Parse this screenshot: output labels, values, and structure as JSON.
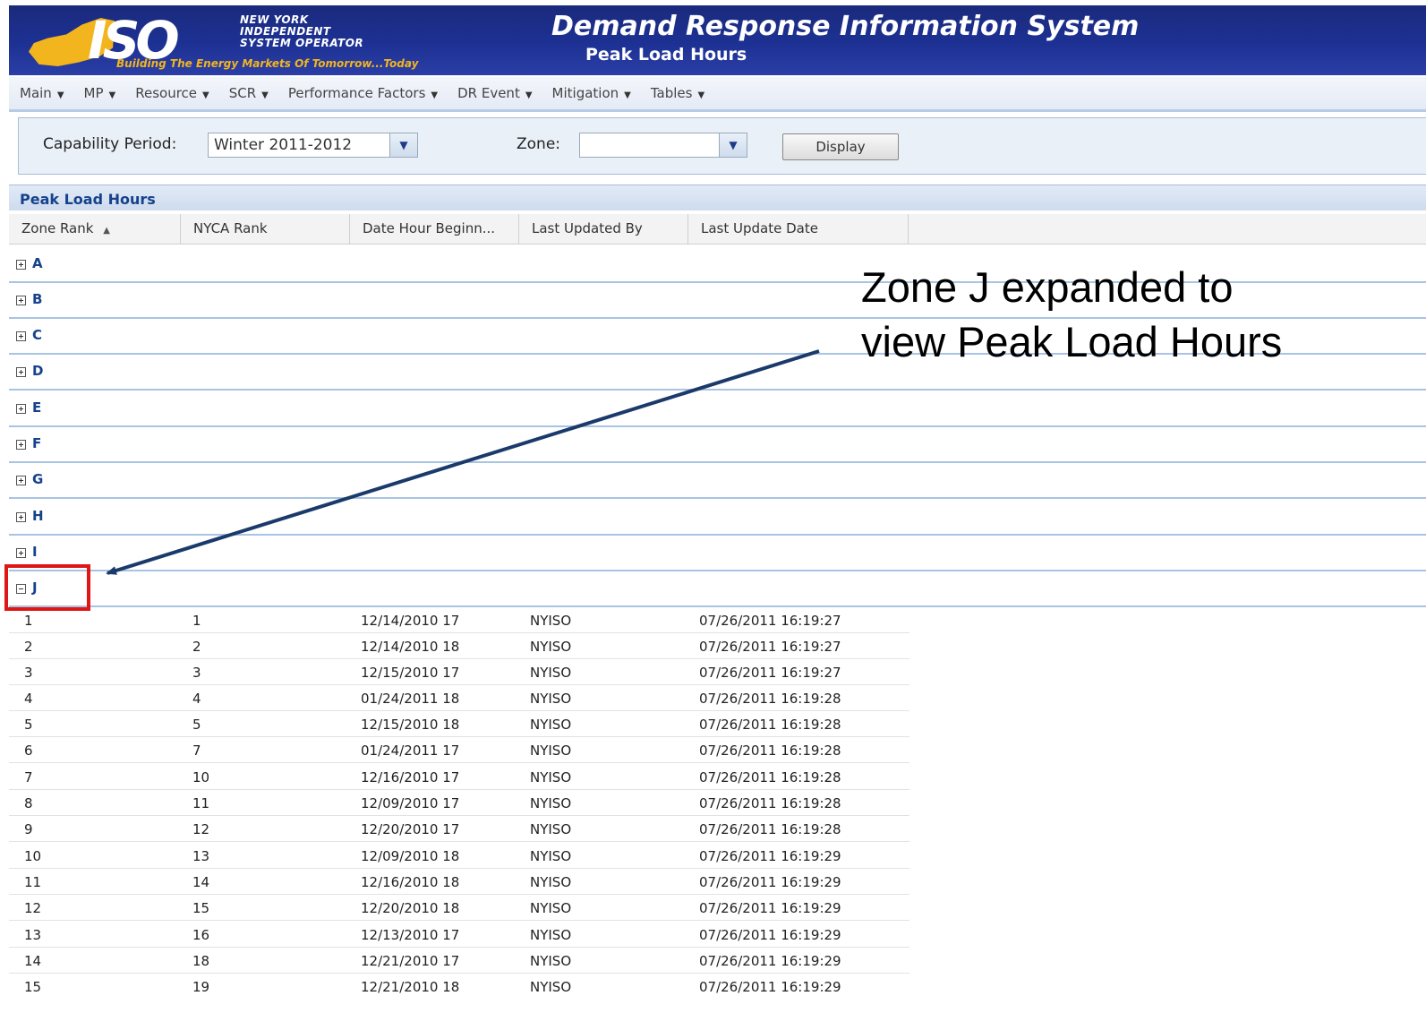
{
  "header": {
    "logo_text": "ISO",
    "logo_lines": [
      "NEW YORK",
      "INDEPENDENT",
      "SYSTEM OPERATOR"
    ],
    "logo_tagline": "Building The Energy Markets Of Tomorrow...Today",
    "app_title": "Demand Response Information System",
    "page_subtitle": "Peak Load Hours"
  },
  "menu": [
    "Main",
    "MP",
    "Resource",
    "SCR",
    "Performance Factors",
    "DR Event",
    "Mitigation",
    "Tables"
  ],
  "filters": {
    "capability_period_label": "Capability Period:",
    "capability_period_value": "Winter 2011-2012",
    "zone_label": "Zone:",
    "zone_value": "",
    "display_button": "Display"
  },
  "grid": {
    "title": "Peak Load Hours",
    "columns": [
      "Zone Rank",
      "NYCA Rank",
      "Date Hour Beginn...",
      "Last Updated By",
      "Last Update Date"
    ],
    "sort_column": "Zone Rank",
    "sort_direction": "ascending",
    "collapsed_groups": [
      "A",
      "B",
      "C",
      "D",
      "E",
      "F",
      "G",
      "H",
      "I"
    ],
    "expanded_group": "J",
    "rows": [
      [
        "1",
        "1",
        "12/14/2010 17",
        "NYISO",
        "07/26/2011 16:19:27"
      ],
      [
        "2",
        "2",
        "12/14/2010 18",
        "NYISO",
        "07/26/2011 16:19:27"
      ],
      [
        "3",
        "3",
        "12/15/2010 17",
        "NYISO",
        "07/26/2011 16:19:27"
      ],
      [
        "4",
        "4",
        "01/24/2011 18",
        "NYISO",
        "07/26/2011 16:19:28"
      ],
      [
        "5",
        "5",
        "12/15/2010 18",
        "NYISO",
        "07/26/2011 16:19:28"
      ],
      [
        "6",
        "7",
        "01/24/2011 17",
        "NYISO",
        "07/26/2011 16:19:28"
      ],
      [
        "7",
        "10",
        "12/16/2010 17",
        "NYISO",
        "07/26/2011 16:19:28"
      ],
      [
        "8",
        "11",
        "12/09/2010 17",
        "NYISO",
        "07/26/2011 16:19:28"
      ],
      [
        "9",
        "12",
        "12/20/2010 17",
        "NYISO",
        "07/26/2011 16:19:28"
      ],
      [
        "10",
        "13",
        "12/09/2010 18",
        "NYISO",
        "07/26/2011 16:19:29"
      ],
      [
        "11",
        "14",
        "12/16/2010 18",
        "NYISO",
        "07/26/2011 16:19:29"
      ],
      [
        "12",
        "15",
        "12/20/2010 18",
        "NYISO",
        "07/26/2011 16:19:29"
      ],
      [
        "13",
        "16",
        "12/13/2010 17",
        "NYISO",
        "07/26/2011 16:19:29"
      ],
      [
        "14",
        "18",
        "12/21/2010 17",
        "NYISO",
        "07/26/2011 16:19:29"
      ],
      [
        "15",
        "19",
        "12/21/2010 18",
        "NYISO",
        "07/26/2011 16:19:29"
      ]
    ]
  },
  "annotation": {
    "text": "Zone J expanded to view Peak Load Hours",
    "arrow_color": "#1a3a6b",
    "highlight_color": "#e01515"
  },
  "colors": {
    "header_bg": "#1d3194",
    "logo_gold": "#f3b51d",
    "group_label": "#15428b",
    "group_border": "#a9c3e3"
  }
}
